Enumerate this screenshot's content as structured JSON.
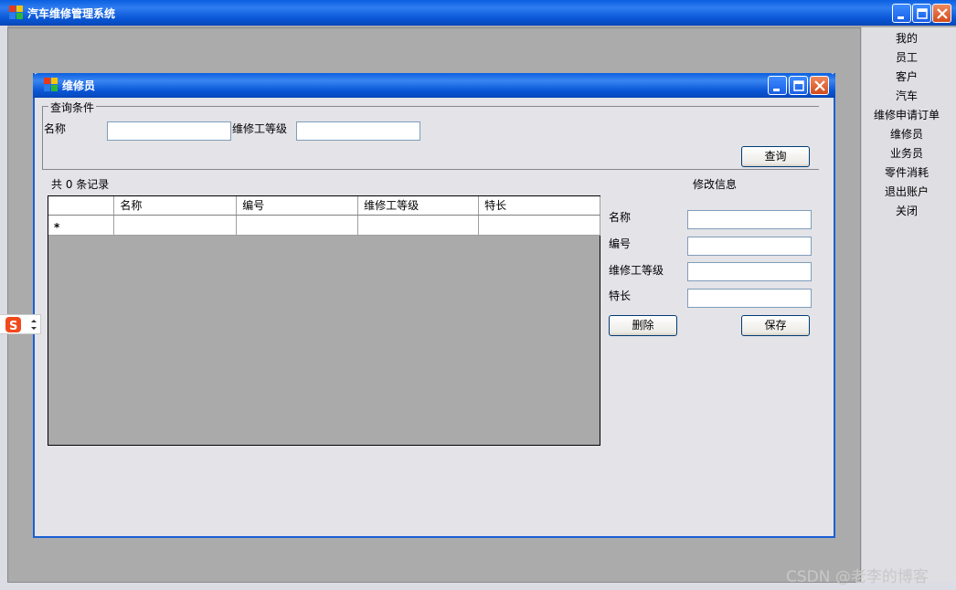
{
  "main_window": {
    "title": "汽车维修管理系统"
  },
  "menu": {
    "items": [
      "我的",
      "员工",
      "客户",
      "汽车",
      "维修申请订单",
      "维修员",
      "业务员",
      "零件消耗",
      "退出账户",
      "关闭"
    ]
  },
  "child_window": {
    "title": "维修员"
  },
  "query": {
    "group_title": "查询条件",
    "name_label": "名称",
    "name_value": "",
    "level_label": "维修工等级",
    "level_value": "",
    "search_button": "查询"
  },
  "record_count": "共 0 条记录",
  "grid": {
    "columns": [
      "",
      "名称",
      "编号",
      "维修工等级",
      "特长"
    ],
    "new_row_marker": "*",
    "rows": []
  },
  "edit": {
    "title": "修改信息",
    "name_label": "名称",
    "name_value": "",
    "id_label": "编号",
    "id_value": "",
    "level_label": "维修工等级",
    "level_value": "",
    "specialty_label": "特长",
    "specialty_value": "",
    "delete_button": "删除",
    "save_button": "保存"
  },
  "watermark": "CSDN @老李的博客",
  "colors": {
    "titlebar": "#0a5fe0",
    "mdi_background": "#ababab",
    "panel": "#e3e3e8"
  }
}
